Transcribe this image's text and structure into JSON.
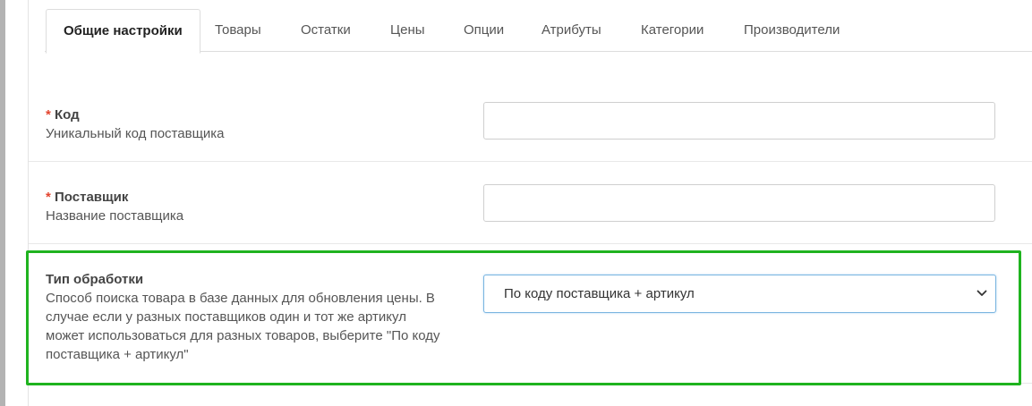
{
  "tabs": [
    {
      "label": "Общие настройки",
      "active": true
    },
    {
      "label": "Товары"
    },
    {
      "label": "Остатки"
    },
    {
      "label": "Цены"
    },
    {
      "label": "Опции"
    },
    {
      "label": "Атрибуты"
    },
    {
      "label": "Категории"
    },
    {
      "label": "Производители"
    }
  ],
  "form": {
    "code": {
      "required_mark": "*",
      "title": "Код",
      "help": "Уникальный код поставщика",
      "value": ""
    },
    "supplier": {
      "required_mark": "*",
      "title": "Поставщик",
      "help": "Название поставщика",
      "value": ""
    },
    "processing_type": {
      "title": "Тип обработки",
      "help_lines": [
        "Способ поиска товара в базе данных для обновления цены. В",
        "случае если у разных поставщиков один и тот же артикул",
        "может использоваться для разных товаров, выберите \"По коду",
        "поставщика + артикул\""
      ],
      "selected": "По коду поставщика + артикул"
    }
  },
  "colors": {
    "highlight": "#1fb31f",
    "required": "#e3442e"
  },
  "icons": {
    "select_arrow": "chevron-down-icon"
  }
}
